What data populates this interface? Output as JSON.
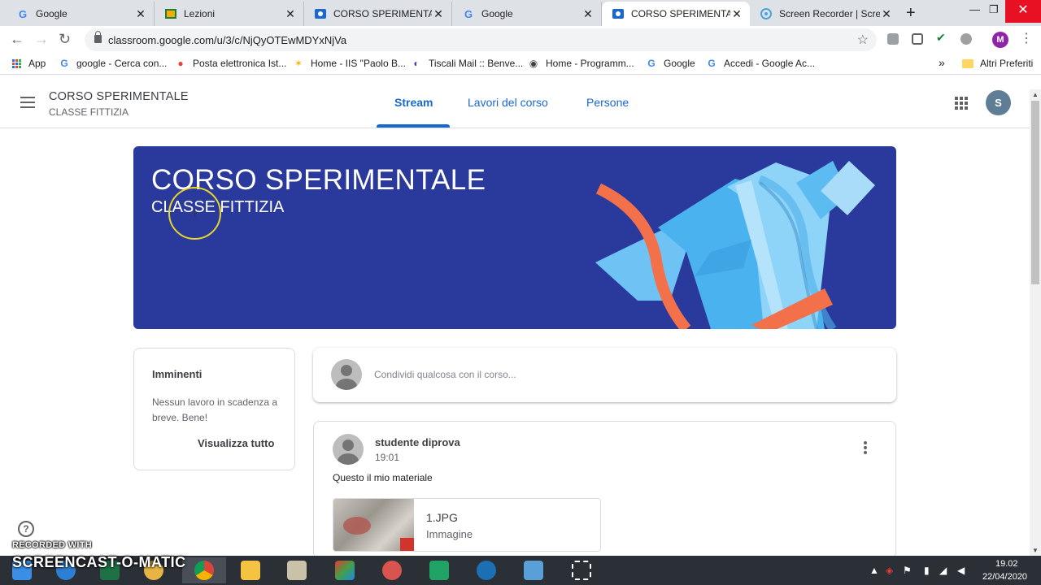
{
  "browser": {
    "tabs": [
      {
        "title": "Google",
        "icon": "google-icon",
        "active": false
      },
      {
        "title": "Lezioni",
        "icon": "classroom-lezioni-icon",
        "active": false
      },
      {
        "title": "CORSO SPERIMENTALE",
        "icon": "classroom-icon",
        "active": false
      },
      {
        "title": "Google",
        "icon": "google-icon",
        "active": false
      },
      {
        "title": "CORSO SPERIMENTALE",
        "icon": "classroom-icon",
        "active": true
      },
      {
        "title": "Screen Recorder | Screen",
        "icon": "screen-recorder-icon",
        "active": false
      }
    ],
    "url": "classroom.google.com/u/3/c/NjQyOTEwMDYxNjVa",
    "profile_initial": "M",
    "bookmarks": [
      {
        "label": "App",
        "icon": "apps-icon"
      },
      {
        "label": "google - Cerca con...",
        "icon": "google-icon"
      },
      {
        "label": "Posta elettronica Ist...",
        "icon": "mail-icon"
      },
      {
        "label": "Home - IIS \"Paolo B...",
        "icon": "joomla-icon"
      },
      {
        "label": "Tiscali Mail :: Benve...",
        "icon": "tiscali-icon"
      },
      {
        "label": "Home - Programm...",
        "icon": "globe-icon"
      },
      {
        "label": "Google",
        "icon": "google-icon"
      },
      {
        "label": "Accedi - Google Ac...",
        "icon": "google-icon"
      }
    ],
    "bookmarks_overflow": "»",
    "other_bookmarks": "Altri Preferiti"
  },
  "classroom": {
    "course_title": "CORSO SPERIMENTALE",
    "course_section": "CLASSE FITTIZIA",
    "tabs": [
      "Stream",
      "Lavori del corso",
      "Persone"
    ],
    "active_tab": "Stream",
    "user_initial": "S",
    "banner": {
      "title": "CORSO SPERIMENTALE",
      "section": "CLASSE FITTIZIA",
      "color": "#2a3a9c"
    },
    "upcoming": {
      "title": "Imminenti",
      "text": "Nessun lavoro in scadenza a breve. Bene!",
      "view_all": "Visualizza tutto"
    },
    "share_placeholder": "Condividi qualcosa con il corso...",
    "post": {
      "author": "studente diprova",
      "time": "19:01",
      "text": "Questo il mio materiale",
      "attachment": {
        "name": "1.JPG",
        "type": "Immagine"
      }
    },
    "help": "?"
  },
  "watermark": {
    "line1": "RECORDED WITH",
    "line2": "SCREENCAST-O-MATIC"
  },
  "taskbar": {
    "time": "19.02",
    "date": "22/04/2020",
    "apps": [
      "windows-start-icon",
      "edge-icon",
      "excel-icon",
      "explorer-icon",
      "chrome-icon",
      "file-explorer-icon",
      "notepad-icon",
      "paint-icon",
      "snipping-icon",
      "excel-icon",
      "globe-icon",
      "photos-icon",
      "screen-capture-icon"
    ]
  },
  "colors": {
    "accent": "#1967d2",
    "banner": "#2a3a9c",
    "taskbar": "#2b2f36"
  }
}
